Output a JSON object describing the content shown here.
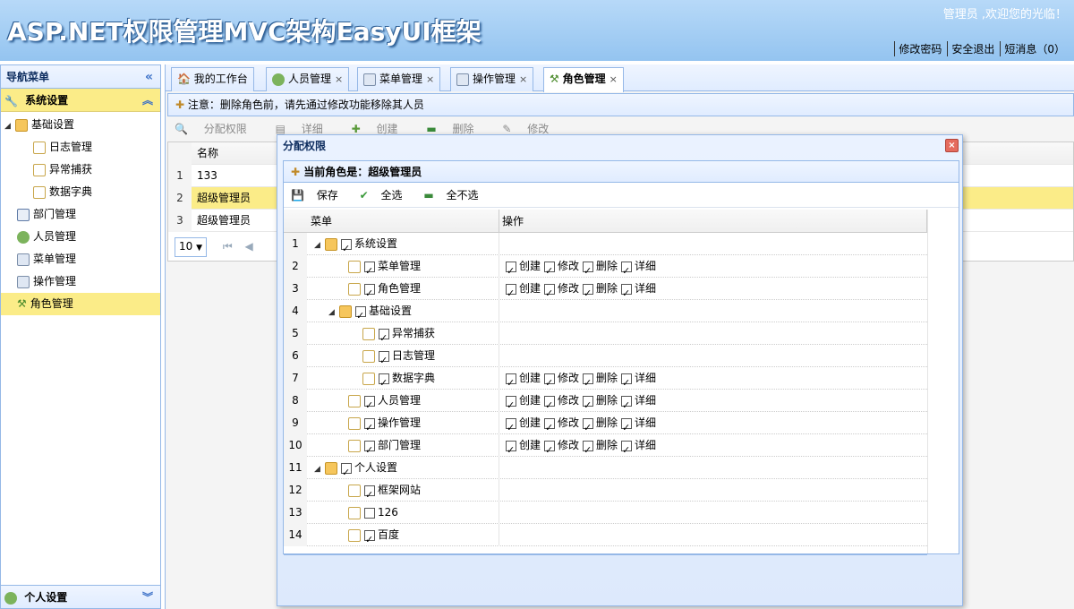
{
  "header": {
    "title": "ASP.NET权限管理MVC架构EasyUI框架",
    "welcome": "管理员 ,欢迎您的光临！",
    "links": [
      "修改密码",
      "安全退出",
      "短消息（0）"
    ]
  },
  "nav": {
    "title": "导航菜单",
    "section1": "系统设置",
    "section2": "个人设置",
    "items": [
      {
        "label": "基础设置",
        "level": 0
      },
      {
        "label": "日志管理",
        "level": 1
      },
      {
        "label": "异常捕获",
        "level": 1
      },
      {
        "label": "数据字典",
        "level": 1
      },
      {
        "label": "部门管理",
        "level": 0
      },
      {
        "label": "人员管理",
        "level": 0
      },
      {
        "label": "菜单管理",
        "level": 0
      },
      {
        "label": "操作管理",
        "level": 0
      },
      {
        "label": "角色管理",
        "level": 0
      }
    ]
  },
  "tabs": [
    "我的工作台",
    "人员管理",
    "菜单管理",
    "操作管理",
    "角色管理"
  ],
  "notice": "注意：删除角色前，请先通过修改功能移除其人员",
  "toolbar": [
    "分配权限",
    "详细",
    "创建",
    "删除",
    "修改"
  ],
  "grid": {
    "header": "名称",
    "rows": [
      "133",
      "超级管理员",
      "超级管理员"
    ],
    "row_numbers": [
      "1",
      "2",
      "3"
    ],
    "page_size": "10"
  },
  "dialog": {
    "title": "分配权限",
    "role_label": "当前角色是：超级管理员",
    "tools": [
      "保存",
      "全选",
      "全不选"
    ],
    "col_menu": "菜单",
    "col_ops": "操作",
    "ops": [
      "创建",
      "修改",
      "删除",
      "详细"
    ],
    "rows": [
      {
        "n": "1",
        "label": "系统设置",
        "level": 0,
        "folder": true,
        "checked": true,
        "ops": false
      },
      {
        "n": "2",
        "label": "菜单管理",
        "level": 1,
        "folder": false,
        "checked": true,
        "ops": true
      },
      {
        "n": "3",
        "label": "角色管理",
        "level": 1,
        "folder": false,
        "checked": true,
        "ops": true
      },
      {
        "n": "4",
        "label": "基础设置",
        "level": 1,
        "folder": true,
        "checked": true,
        "ops": false
      },
      {
        "n": "5",
        "label": "异常捕获",
        "level": 2,
        "folder": false,
        "checked": true,
        "ops": false
      },
      {
        "n": "6",
        "label": "日志管理",
        "level": 2,
        "folder": false,
        "checked": true,
        "ops": false
      },
      {
        "n": "7",
        "label": "数据字典",
        "level": 2,
        "folder": false,
        "checked": true,
        "ops": true
      },
      {
        "n": "8",
        "label": "人员管理",
        "level": 1,
        "folder": false,
        "checked": true,
        "ops": true
      },
      {
        "n": "9",
        "label": "操作管理",
        "level": 1,
        "folder": false,
        "checked": true,
        "ops": true
      },
      {
        "n": "10",
        "label": "部门管理",
        "level": 1,
        "folder": false,
        "checked": true,
        "ops": true
      },
      {
        "n": "11",
        "label": "个人设置",
        "level": 0,
        "folder": true,
        "checked": true,
        "ops": false
      },
      {
        "n": "12",
        "label": "框架网站",
        "level": 1,
        "folder": false,
        "checked": true,
        "ops": false
      },
      {
        "n": "13",
        "label": "126",
        "level": 1,
        "folder": false,
        "checked": false,
        "ops": false
      },
      {
        "n": "14",
        "label": "百度",
        "level": 1,
        "folder": false,
        "checked": true,
        "ops": false
      }
    ]
  }
}
